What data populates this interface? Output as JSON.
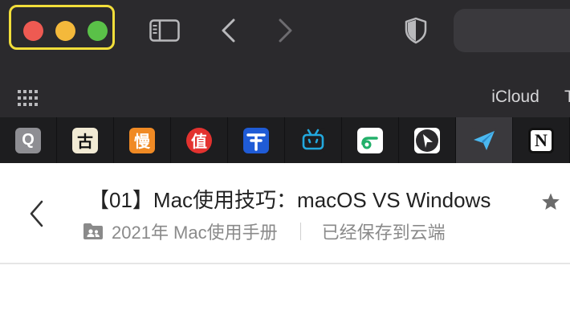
{
  "browser": {
    "bookmarks_bar": {
      "items": [
        "iCloud",
        "T"
      ]
    },
    "tabs": [
      {
        "icon": "quora-icon",
        "glyph": "Q",
        "bg": "#8e8e93",
        "fg": "#ffffff",
        "active": false
      },
      {
        "icon": "gu-icon",
        "glyph": "古",
        "bg": "#f1ead4",
        "fg": "#111111",
        "active": false
      },
      {
        "icon": "man-icon",
        "glyph": "慢",
        "bg": "#f08a24",
        "fg": "#ffffff",
        "active": false
      },
      {
        "icon": "smzdm-icon",
        "glyph": "值",
        "bg": "#e3322f",
        "fg": "#ffffff",
        "active": false
      },
      {
        "icon": "translate-icon",
        "glyph": "",
        "bg": "#1f5bd6",
        "fg": "#ffffff",
        "active": false
      },
      {
        "icon": "bilibili-icon",
        "glyph": "",
        "bg": "#1d1d1f",
        "fg": "#22a8dd",
        "active": false
      },
      {
        "icon": "link-icon",
        "glyph": "",
        "bg": "#ffffff",
        "fg": "#22b06a",
        "active": false
      },
      {
        "icon": "compass-icon",
        "glyph": "",
        "bg": "#ffffff",
        "fg": "#2b2a2d",
        "active": false
      },
      {
        "icon": "send-icon",
        "glyph": "",
        "bg": "#3a393d",
        "fg": "#4bb8f0",
        "active": true
      },
      {
        "icon": "notion-icon",
        "glyph": "N",
        "bg": "#ffffff",
        "fg": "#111111",
        "active": false
      }
    ]
  },
  "page": {
    "title": "【01】Mac使用技巧：macOS VS Windows",
    "notebook": "2021年 Mac使用手册",
    "save_status": "已经保存到云端"
  },
  "colors": {
    "toolbar_bg": "#2b2a2d",
    "tabbar_bg": "#1d1d1f",
    "highlight": "#f2de3a",
    "close": "#ee5a52",
    "minimize": "#f4b93b",
    "zoom": "#5ac148"
  }
}
